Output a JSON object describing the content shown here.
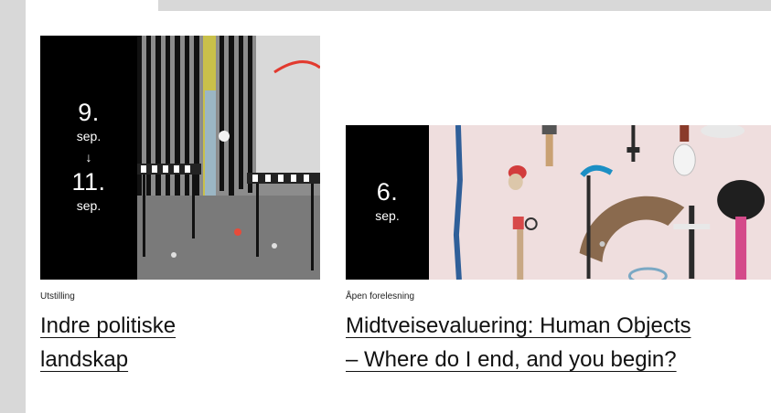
{
  "cards": [
    {
      "date_start_day": "9.",
      "date_start_month": "sep.",
      "date_arrow": "↓",
      "date_end_day": "11.",
      "date_end_month": "sep.",
      "category": "Utstilling",
      "title_line1": "Indre politiske",
      "title_line2": "landskap"
    },
    {
      "date_day": "6.",
      "date_month": "sep.",
      "category": "Åpen forelesning",
      "title_line1": "Midtveisevaluering: Human Objects",
      "title_line2": "– Where do I end, and you begin?"
    }
  ],
  "colors": {
    "date_bg": "#000000",
    "page_bg": "#ffffff",
    "frame_bg": "#d8d8d8"
  }
}
